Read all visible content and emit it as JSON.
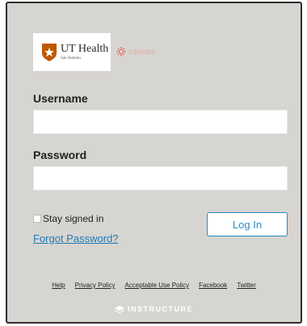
{
  "branding": {
    "org_name": "UT Health",
    "org_subtitle": "San Antonio",
    "product_name": "canvas",
    "vendor_name": "INSTRUCTURE",
    "colors": {
      "frame_bg": "#d7d5d1",
      "accent_blue": "#2b89c5",
      "link_blue": "#1d7ab5",
      "ut_orange": "#bf5700",
      "canvas_red": "#e66b5b"
    }
  },
  "login": {
    "username_label": "Username",
    "username_value": "",
    "password_label": "Password",
    "password_value": "",
    "stay_signed_in_label": "Stay signed in",
    "stay_signed_in_checked": false,
    "forgot_password_label": "Forgot Password?",
    "login_button_label": "Log In"
  },
  "footer": {
    "links": [
      {
        "label": "Help"
      },
      {
        "label": "Privacy Policy"
      },
      {
        "label": "Acceptable Use Policy"
      },
      {
        "label": "Facebook"
      },
      {
        "label": "Twitter"
      }
    ]
  },
  "icons": {
    "org_logo": "shield-star-icon",
    "canvas_logo": "canvas-dots-icon",
    "instructure_logo": "instructure-icon"
  }
}
